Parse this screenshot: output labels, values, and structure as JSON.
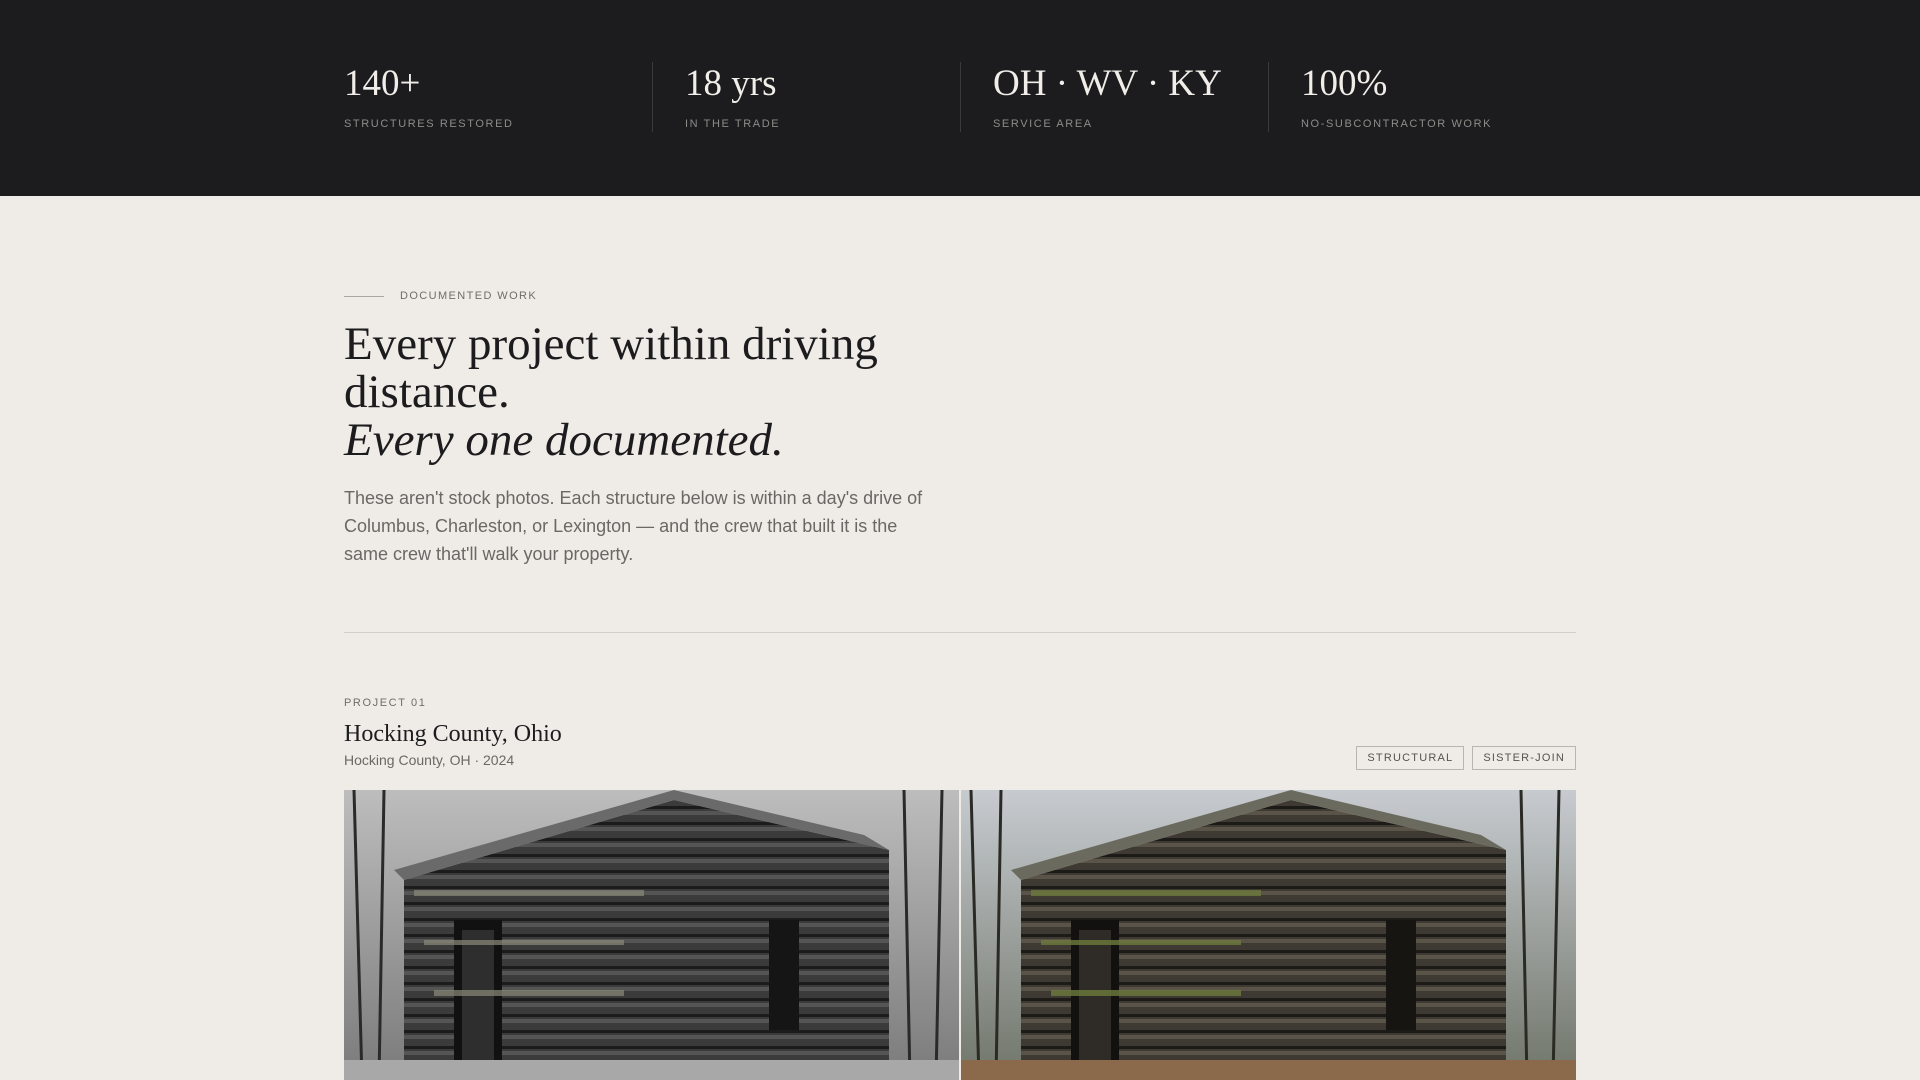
{
  "stats": [
    {
      "value": "140+",
      "label": "STRUCTURES RESTORED"
    },
    {
      "value": "18 yrs",
      "label": "IN THE TRADE"
    },
    {
      "value": "OH · WV · KY",
      "label": "SERVICE AREA"
    },
    {
      "value": "100%",
      "label": "NO-SUBCONTRACTOR WORK"
    }
  ],
  "intro": {
    "eyebrow": "DOCUMENTED WORK",
    "headline_line1": "Every project within driving distance.",
    "headline_line2": "Every one documented.",
    "lede": "These aren't stock photos. Each structure below is within a day's drive of Columbus, Charleston, or Lexington — and the crew that built it is the same crew that'll walk your property."
  },
  "project": {
    "number": "PROJECT 01",
    "title": "Hocking County, Ohio",
    "meta": "Hocking County, OH · 2024",
    "tags": [
      "STRUCTURAL",
      "SISTER-JOIN"
    ]
  },
  "colors": {
    "band": "#1c1c1e",
    "page": "#efece7",
    "text": "#1c1c1e",
    "muted": "#6a6865"
  }
}
